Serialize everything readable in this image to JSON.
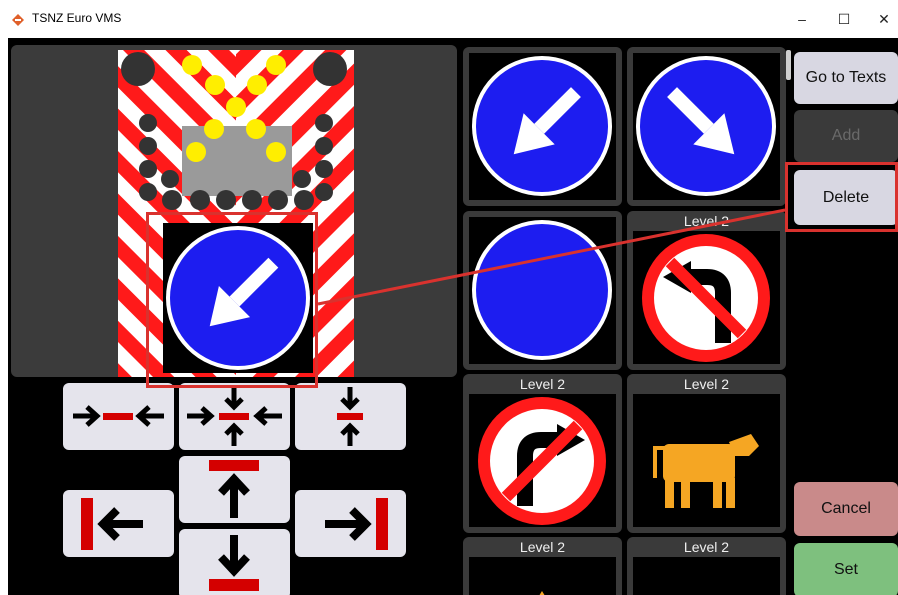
{
  "window": {
    "title": "TSNZ Euro VMS",
    "minimize_glyph": "–",
    "maximize_glyph": "☐",
    "close_glyph": "✕"
  },
  "sign_tiles": [
    {
      "label": "",
      "icon": "keep-left-arrow-icon"
    },
    {
      "label": "",
      "icon": "keep-right-arrow-icon"
    },
    {
      "label": "",
      "icon": "blank-blue-disc-icon"
    },
    {
      "label": "Level 2",
      "icon": "no-left-turn-icon"
    },
    {
      "label": "Level 2",
      "icon": "no-right-turn-icon"
    },
    {
      "label": "Level 2",
      "icon": "cattle-warning-icon"
    },
    {
      "label": "Level 2",
      "icon": "warning-sign-icon"
    },
    {
      "label": "Level 2",
      "icon": "warning-sign-icon"
    }
  ],
  "side_buttons": {
    "go_to_texts": "Go to Texts",
    "add": "Add",
    "delete": "Delete",
    "cancel": "Cancel",
    "set": "Set"
  },
  "colors": {
    "highlight": "#d9322e",
    "sign_blue": "#1d1df0",
    "chevron_red": "#ff1a1a",
    "cattle_orange": "#f5a623",
    "cancel_bg": "#c98a8a",
    "set_bg": "#7ec07e",
    "delete_bg": "#d8d7e2",
    "button_bg": "#d8d7e2"
  }
}
